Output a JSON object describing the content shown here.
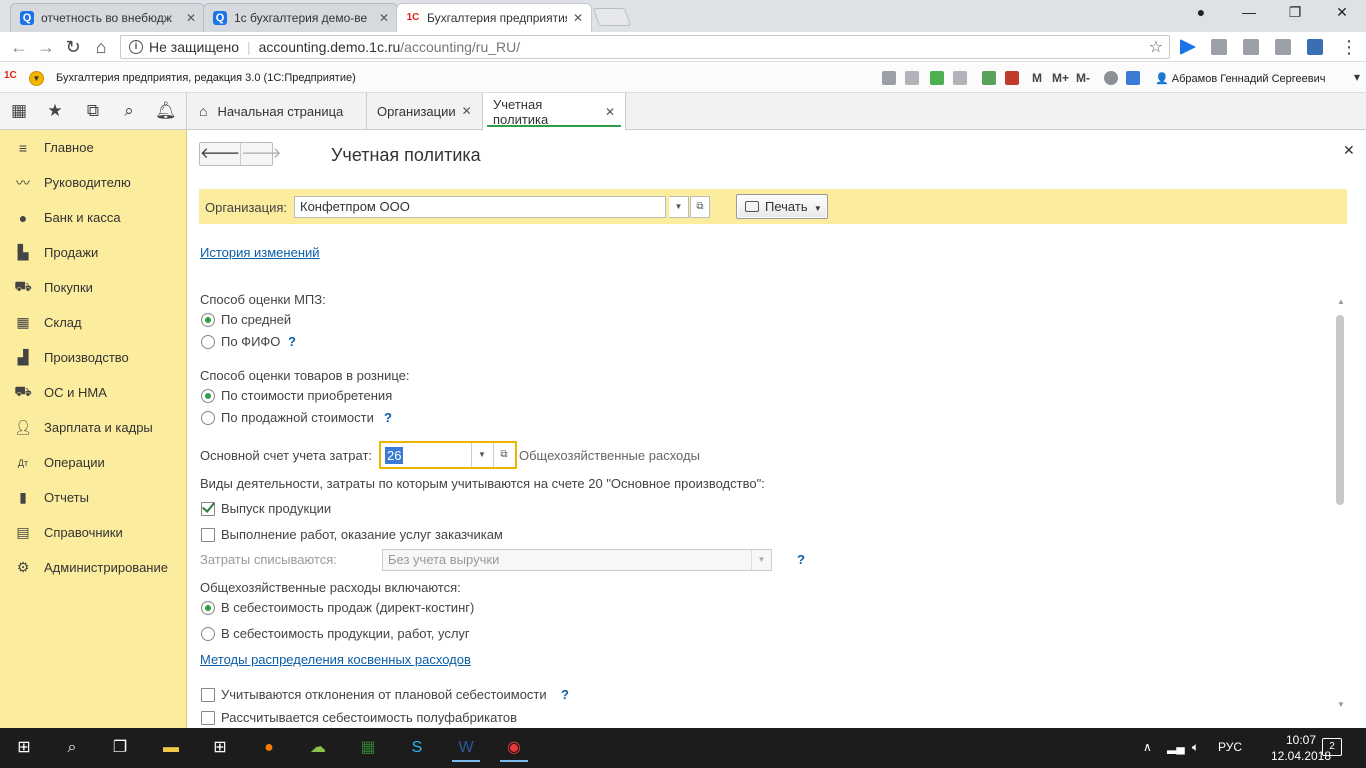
{
  "browser": {
    "tabs": [
      {
        "title": "отчетность во внебюдж",
        "icon": "search-icon"
      },
      {
        "title": "1с бухгалтерия демо-ве",
        "icon": "search-icon"
      },
      {
        "title": "Бухгалтерия предприятия",
        "icon": "1c-icon",
        "active": true
      }
    ],
    "security_text": "Не защищено",
    "url_host": "accounting.demo.1c.ru",
    "url_path": "/accounting/ru_RU/"
  },
  "app": {
    "logo": "1С",
    "title": "Бухгалтерия предприятия, редакция 3.0  (1С:Предприятие)",
    "memory_buttons": [
      "M",
      "M+",
      "M-"
    ],
    "user": "Абрамов Геннадий Сергеевич"
  },
  "sections": [
    {
      "label": "Главное",
      "icon": "menu-icon"
    },
    {
      "label": "Руководителю",
      "icon": "trend-icon"
    },
    {
      "label": "Банк и касса",
      "icon": "coin-icon"
    },
    {
      "label": "Продажи",
      "icon": "bag-icon"
    },
    {
      "label": "Покупки",
      "icon": "cart-icon"
    },
    {
      "label": "Склад",
      "icon": "warehouse-icon"
    },
    {
      "label": "Производство",
      "icon": "factory-icon"
    },
    {
      "label": "ОС и НМА",
      "icon": "truck-icon"
    },
    {
      "label": "Зарплата и кадры",
      "icon": "person-icon"
    },
    {
      "label": "Операции",
      "icon": "dt-kt-icon"
    },
    {
      "label": "Отчеты",
      "icon": "bar-chart-icon"
    },
    {
      "label": "Справочники",
      "icon": "book-icon"
    },
    {
      "label": "Администрирование",
      "icon": "gear-icon"
    }
  ],
  "window_tabs": [
    {
      "label": "Начальная страница",
      "icon": "home-icon",
      "closable": false
    },
    {
      "label": "Организации",
      "closable": true
    },
    {
      "label": "Учетная политика",
      "closable": true,
      "active": true
    }
  ],
  "form": {
    "title": "Учетная политика",
    "org_label": "Организация:",
    "org_value": "Конфетпром ООО",
    "print_label": "Печать",
    "history_link": "История изменений",
    "mpz_label": "Способ оценки МПЗ:",
    "mpz_options": [
      "По средней",
      "По ФИФО"
    ],
    "mpz_selected": 0,
    "retail_label": "Способ оценки товаров в рознице:",
    "retail_options": [
      "По стоимости приобретения",
      "По продажной стоимости"
    ],
    "retail_selected": 0,
    "cost_account_label": "Основной счет учета затрат:",
    "cost_account_value": "26",
    "cost_account_name": "Общехозяйственные расходы",
    "activity_label": "Виды деятельности, затраты по которым учитываются на счете 20 \"Основное производство\":",
    "activity_products": "Выпуск продукции",
    "activity_products_checked": true,
    "activity_services": "Выполнение работ, оказание услуг заказчикам",
    "activity_services_checked": false,
    "writeoff_label": "Затраты списываются:",
    "writeoff_value": "Без учета выручки",
    "overhead_label": "Общехозяйственные расходы включаются:",
    "overhead_options": [
      "В себестоимость продаж (директ-костинг)",
      "В  себестоимость продукции, работ, услуг"
    ],
    "overhead_selected": 0,
    "methods_link": "Методы распределения косвенных расходов",
    "deviations_label": "Учитываются отклонения от плановой себестоимости",
    "semi_label": "Рассчитывается себестоимость полуфабрикатов",
    "help_mark": "?"
  },
  "taskbar": {
    "lang": "РУС",
    "time": "10:07",
    "date": "12.04.2018",
    "notifications": "2"
  }
}
